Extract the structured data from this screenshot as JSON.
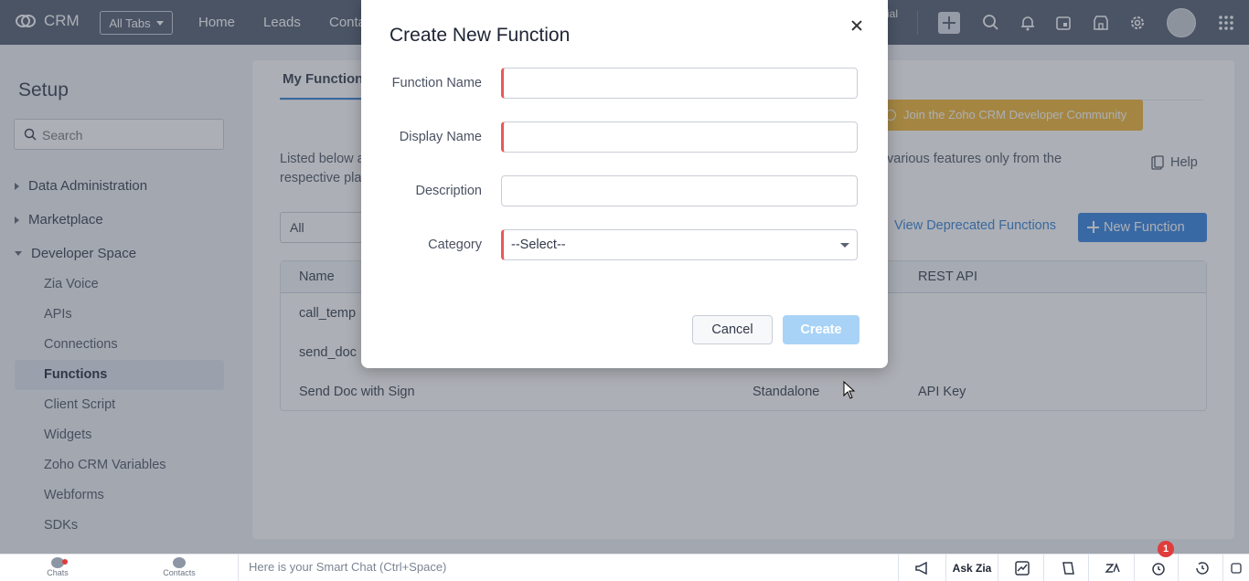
{
  "app": {
    "name": "CRM"
  },
  "topnav": {
    "all_tabs_label": "All Tabs",
    "tabs": [
      "Home",
      "Leads",
      "Conta"
    ],
    "partial_text": "ial"
  },
  "sidebar": {
    "title": "Setup",
    "search_placeholder": "Search",
    "sections": [
      {
        "label": "Data Administration",
        "expanded": false
      },
      {
        "label": "Marketplace",
        "expanded": false
      },
      {
        "label": "Developer Space",
        "expanded": true
      }
    ],
    "developer_items": [
      {
        "label": "Zia Voice",
        "active": false
      },
      {
        "label": "APIs",
        "active": false
      },
      {
        "label": "Connections",
        "active": false
      },
      {
        "label": "Functions",
        "active": true
      },
      {
        "label": "Client Script",
        "active": false
      },
      {
        "label": "Widgets",
        "active": false
      },
      {
        "label": "Zoho CRM Variables",
        "active": false
      },
      {
        "label": "Webforms",
        "active": false
      },
      {
        "label": "SDKs",
        "active": false
      }
    ]
  },
  "main": {
    "tab_label": "My Function",
    "community_label": "Join the Zoho CRM Developer Community",
    "desc_line1": "Listed below a",
    "desc_line2": "respective pla",
    "desc_right": "various features only from the",
    "help_label": "Help",
    "filter_value": "All",
    "deprecated_link": "View Deprecated Functions",
    "new_function_label": "New Function",
    "table": {
      "headers": [
        "Name",
        "REST API"
      ],
      "rows": [
        {
          "name": "call_temp",
          "category": "",
          "rest": ""
        },
        {
          "name": "send_doc",
          "category": "",
          "rest": ""
        },
        {
          "name": "Send Doc with Sign",
          "category": "Standalone",
          "rest": "API Key"
        }
      ]
    }
  },
  "modal": {
    "title": "Create New Function",
    "fields": {
      "function_name": {
        "label": "Function Name",
        "value": ""
      },
      "display_name": {
        "label": "Display Name",
        "value": ""
      },
      "description": {
        "label": "Description",
        "value": ""
      },
      "category": {
        "label": "Category",
        "value": "--Select--"
      }
    },
    "cancel_label": "Cancel",
    "create_label": "Create"
  },
  "bottombar": {
    "chats_label": "Chats",
    "contacts_label": "Contacts",
    "smart_chat_placeholder": "Here is your Smart Chat (Ctrl+Space)",
    "ask_zia_label": "Ask Zia",
    "alarm_badge": "1"
  },
  "colors": {
    "topnav": "#4d5a6e",
    "accent_blue": "#2f80e0",
    "required_red": "#e8585a",
    "community_bg": "#f1b42f",
    "create_disabled": "#a9d3f6"
  }
}
